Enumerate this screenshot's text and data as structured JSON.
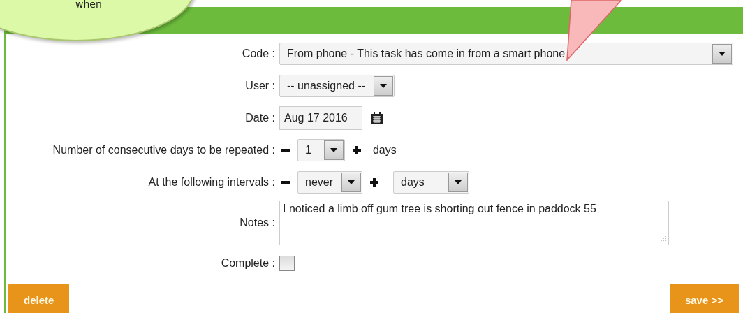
{
  "callout": {
    "text": "when"
  },
  "fields": [
    {
      "kind": "select",
      "label": "Code :",
      "value": "From phone - This task has come in from a smart phone",
      "wide": true
    },
    {
      "kind": "select",
      "label": "User :",
      "value": "-- unassigned --",
      "wide": false
    },
    {
      "kind": "date",
      "label": "Date :",
      "value": "Aug 17 2016"
    },
    {
      "kind": "stepper",
      "label": "Number of consecutive days to be repeated :",
      "value": "1",
      "unit": "days"
    },
    {
      "kind": "interval",
      "label": "At the following intervals :",
      "value": "never",
      "unit": "days"
    },
    {
      "kind": "textarea",
      "label": "Notes :",
      "value": "I noticed a limb off gum tree is shorting out fence in paddock 55"
    },
    {
      "kind": "checkbox",
      "label": "Complete :",
      "checked": false
    }
  ],
  "buttons": [
    {
      "label": "delete"
    },
    {
      "label": "save >>"
    }
  ]
}
